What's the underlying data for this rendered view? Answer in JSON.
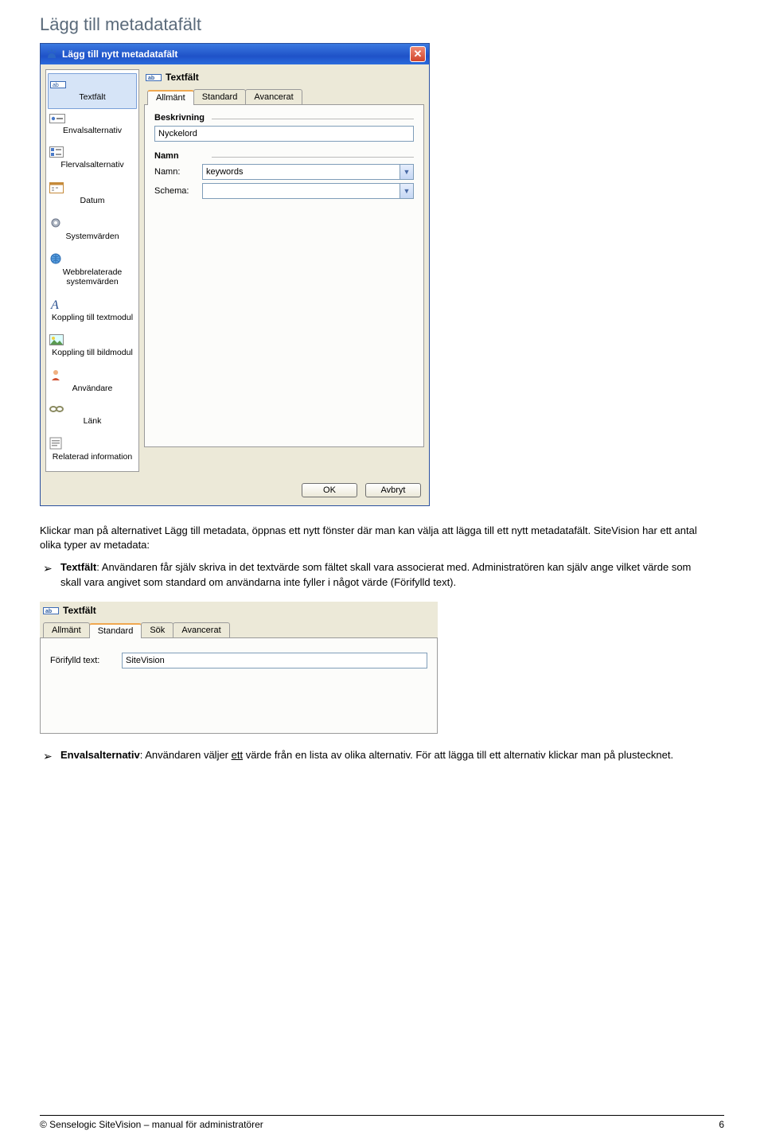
{
  "page": {
    "title": "Lägg till metadatafält",
    "intro": "Klickar man på alternativet Lägg till metadata, öppnas ett nytt fönster där man kan välja att lägga till ett nytt metadatafält. SiteVision har ett antal olika typer av metadata:",
    "bullet1_label": "Textfält",
    "bullet1_text": ": Användaren får själv skriva in det textvärde som fältet skall vara associerat med. Administratören kan själv ange vilket värde som skall vara angivet som standard om användarna inte fyller i något värde (Förifylld text).",
    "bullet2_label": "Envalsalternativ",
    "bullet2_text": ": Användaren väljer ",
    "bullet2_text_ul": "ett",
    "bullet2_text_after": " värde från en lista av olika alternativ. För att lägga till ett alternativ klickar man på plustecknet."
  },
  "dialog": {
    "title": "Lägg till nytt metadatafält",
    "sidebar": [
      {
        "label": "Textfält",
        "icon": "textfield"
      },
      {
        "label": "Envalsalternativ",
        "icon": "radio"
      },
      {
        "label": "Flervalsalternativ",
        "icon": "checkgrid"
      },
      {
        "label": "Datum",
        "icon": "calendar"
      },
      {
        "label": "Systemvärden",
        "icon": "gear"
      },
      {
        "label": "Webbrelaterade systemvärden",
        "icon": "globe"
      },
      {
        "label": "Koppling till textmodul",
        "icon": "letterA"
      },
      {
        "label": "Koppling till bildmodul",
        "icon": "picture"
      },
      {
        "label": "Användare",
        "icon": "user"
      },
      {
        "label": "Länk",
        "icon": "link"
      },
      {
        "label": "Relaterad information",
        "icon": "relinfo"
      }
    ],
    "panel_title": "Textfält",
    "tabs": [
      "Allmänt",
      "Standard",
      "Avancerat"
    ],
    "group_description": "Beskrivning",
    "description_value": "Nyckelord",
    "group_name": "Namn",
    "name_label": "Namn:",
    "name_value": "keywords",
    "schema_label": "Schema:",
    "schema_value": "",
    "ok": "OK",
    "cancel": "Avbryt"
  },
  "mini": {
    "panel_title": "Textfält",
    "tabs": [
      "Allmänt",
      "Standard",
      "Sök",
      "Avancerat"
    ],
    "prefilled_label": "Förifylld text:",
    "prefilled_value": "SiteVision"
  },
  "footer": {
    "left": "© Senselogic SiteVision – manual för administratörer",
    "right": "6"
  }
}
